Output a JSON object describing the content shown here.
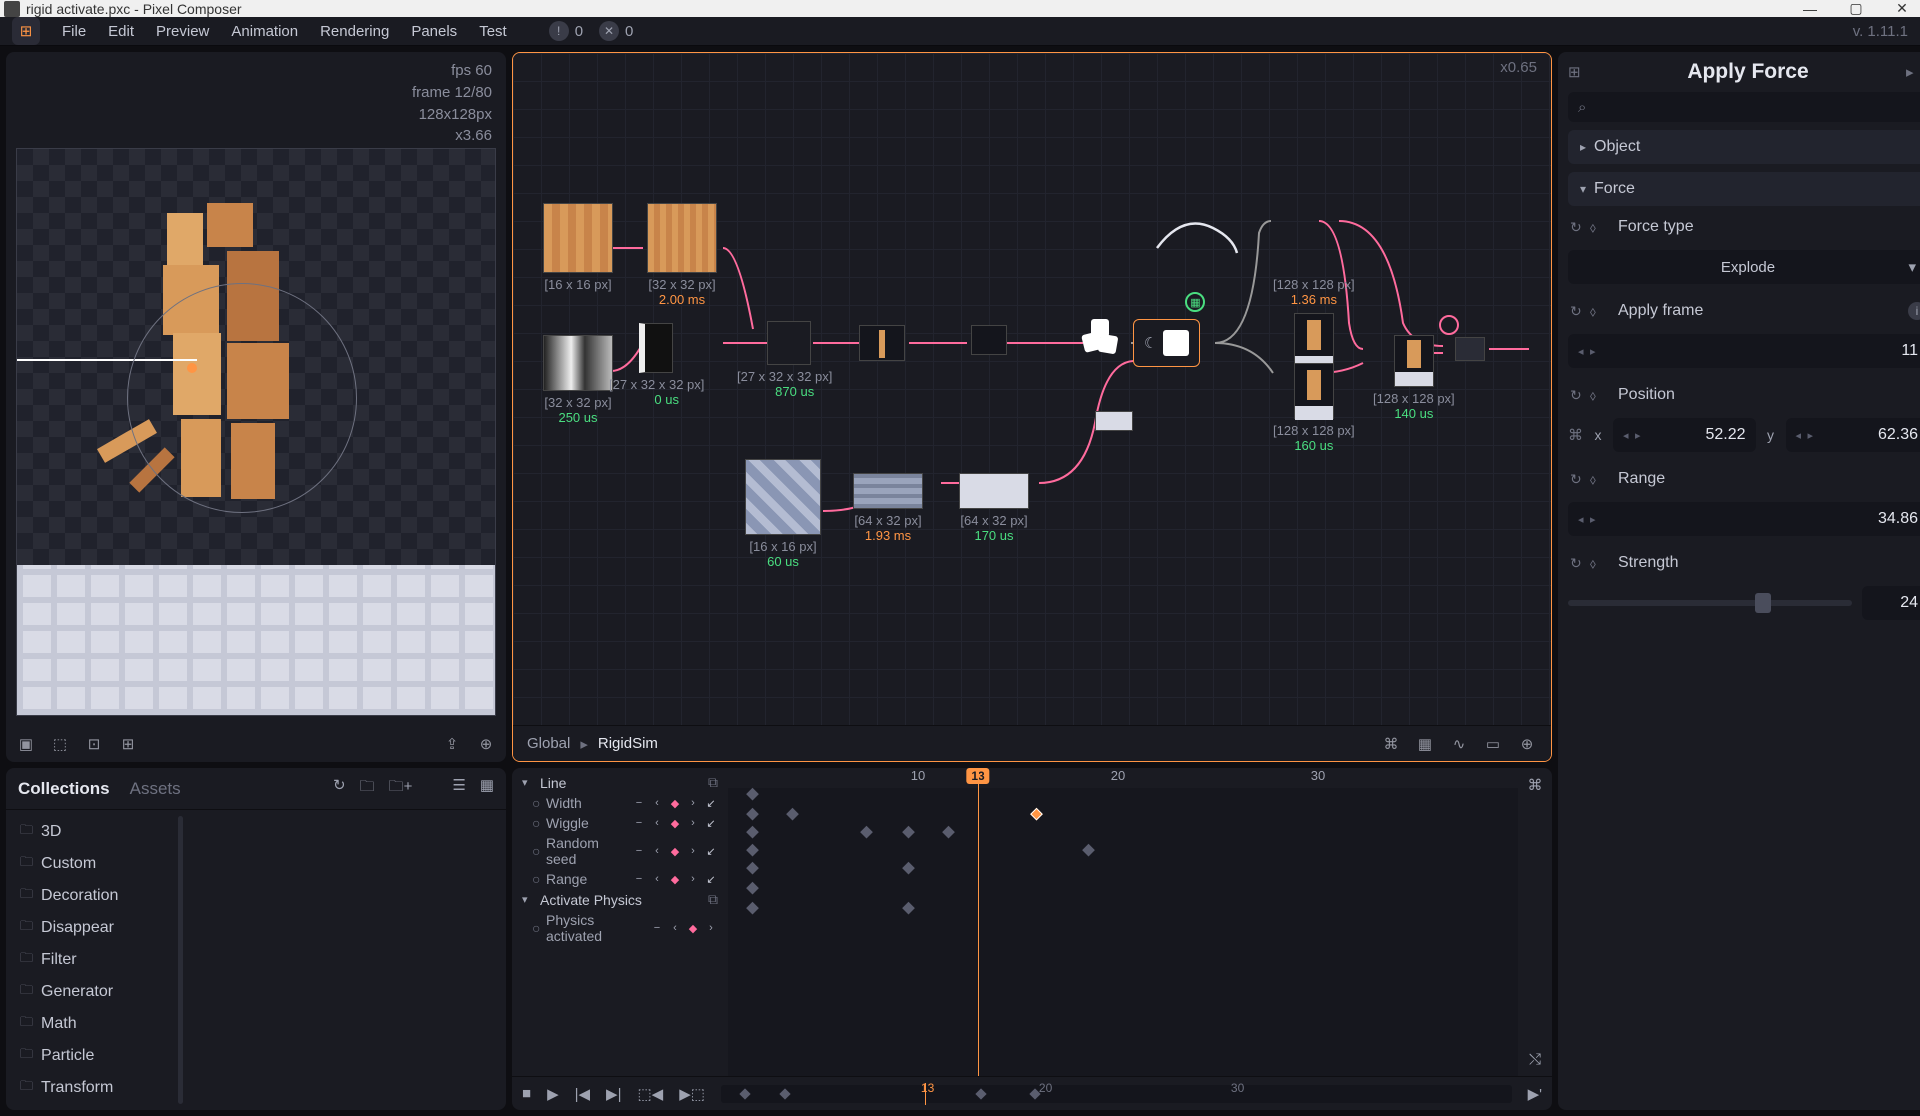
{
  "title": "rigid activate.pxc - Pixel Composer",
  "version": "v. 1.11.1",
  "menu": [
    "File",
    "Edit",
    "Preview",
    "Animation",
    "Rendering",
    "Panels",
    "Test"
  ],
  "badges": {
    "a": "0",
    "b": "0"
  },
  "preview": {
    "fps": "fps 60",
    "frame": "frame 12/80",
    "res": "128x128px",
    "zoom": "x3.66"
  },
  "graph": {
    "zoom": "x0.65",
    "crumbs": [
      "Global",
      "RigidSim"
    ]
  },
  "nodes": {
    "n1": {
      "dim": "[16 x 16 px]"
    },
    "n2": {
      "dim": "[32 x 32 px]",
      "time": "2.00 ms",
      "tc": "t-orange"
    },
    "n3": {
      "dim": "[32 x 32 px]",
      "time": "250 us",
      "tc": "t-green"
    },
    "n4": {
      "dim": "[27 x 32 x 32 px]",
      "time": "0 us",
      "tc": "t-green"
    },
    "n5": {
      "dim": "[27 x 32 x 32 px]",
      "time": "870 us",
      "tc": "t-green"
    },
    "n7": {
      "dim": "[128 x 128 px]",
      "time": "1.36 ms",
      "tc": "t-orange"
    },
    "n8": {
      "dim": "[128 x 128 px]",
      "time": "160 us",
      "tc": "t-green"
    },
    "n9": {
      "dim": "[128 x 128 px]",
      "time": "140 us",
      "tc": "t-green"
    },
    "n10": {
      "dim": "[16 x 16 px]",
      "time": "60 us",
      "tc": "t-green"
    },
    "n11": {
      "dim": "[64 x 32 px]",
      "time": "1.93 ms",
      "tc": "t-orange"
    },
    "n12": {
      "dim": "[64 x 32 px]",
      "time": "170 us",
      "tc": "t-green"
    }
  },
  "inspector": {
    "title": "Apply Force",
    "search_ph": "",
    "sections": {
      "object": "Object",
      "force": "Force"
    },
    "props": {
      "forceType": {
        "label": "Force type",
        "value": "Explode"
      },
      "applyFrame": {
        "label": "Apply frame",
        "value": "11"
      },
      "position": {
        "label": "Position",
        "x": "52.22",
        "y": "62.36"
      },
      "range": {
        "label": "Range",
        "value": "34.86"
      },
      "strength": {
        "label": "Strength",
        "value": "24"
      }
    }
  },
  "collections": {
    "tabs": [
      "Collections",
      "Assets"
    ],
    "folders": [
      "3D",
      "Custom",
      "Decoration",
      "Disappear",
      "Filter",
      "Generator",
      "Math",
      "Particle",
      "Transform"
    ]
  },
  "timeline": {
    "groups": [
      {
        "name": "Line",
        "tracks": [
          "Width",
          "Wiggle",
          "Random seed",
          "Range"
        ]
      },
      {
        "name": "Activate Physics",
        "tracks": [
          "Physics activated"
        ]
      }
    ],
    "ruler": [
      "10",
      "20",
      "30"
    ],
    "playhead": "13",
    "mini": {
      "ph": "13",
      "marks": [
        "20",
        "30"
      ]
    }
  }
}
